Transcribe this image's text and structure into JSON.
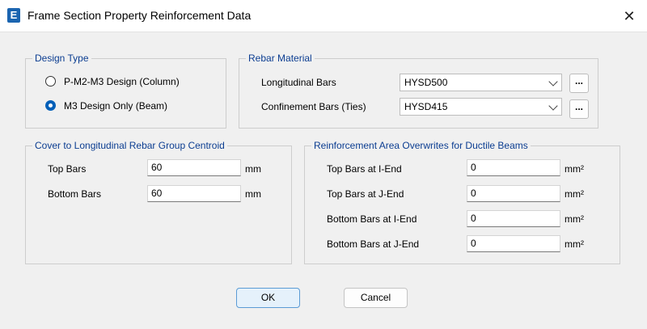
{
  "window": {
    "icon_letter": "E",
    "title": "Frame Section Property Reinforcement Data",
    "close_glyph": "✕"
  },
  "design_type": {
    "legend": "Design Type",
    "options": [
      {
        "label": "P-M2-M3 Design  (Column)",
        "checked": false
      },
      {
        "label": "M3 Design Only  (Beam)",
        "checked": true
      }
    ]
  },
  "rebar_material": {
    "legend": "Rebar Material",
    "longitudinal": {
      "label": "Longitudinal Bars",
      "value": "HYSD500",
      "button": "..."
    },
    "confinement": {
      "label": "Confinement Bars (Ties)",
      "value": "HYSD415",
      "button": "..."
    }
  },
  "cover": {
    "legend": "Cover to Longitudinal Rebar Group Centroid",
    "top": {
      "label": "Top Bars",
      "value": "60",
      "unit": "mm"
    },
    "bottom": {
      "label": "Bottom  Bars",
      "value": "60",
      "unit": "mm"
    }
  },
  "overwrites": {
    "legend": "Reinforcement Area Overwrites for Ductile Beams",
    "rows": [
      {
        "label": "Top Bars at I-End",
        "value": "0",
        "unit": "mm²"
      },
      {
        "label": "Top Bars at J-End",
        "value": "0",
        "unit": "mm²"
      },
      {
        "label": "Bottom Bars at I-End",
        "value": "0",
        "unit": "mm²"
      },
      {
        "label": "Bottom Bars at J-End",
        "value": "0",
        "unit": "mm²"
      }
    ]
  },
  "buttons": {
    "ok": "OK",
    "cancel": "Cancel"
  },
  "colors": {
    "legend": "#0b3d91",
    "accent": "#005fb8"
  }
}
